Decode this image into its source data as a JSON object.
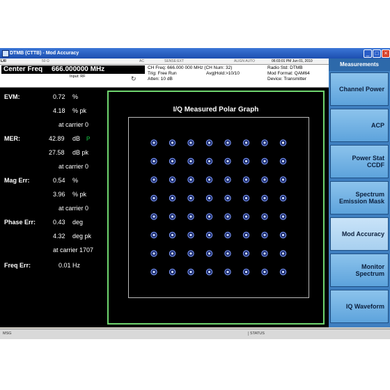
{
  "window": {
    "title": "DTMB (CTTB) - Mod Accuracy",
    "controls": [
      "minimize",
      "maximize",
      "close"
    ]
  },
  "menubar": [
    "50 Ω",
    "AC",
    "SENSE:EXT",
    "ALIGN AUTO",
    "06:03:01 PM Jun 01, 2010"
  ],
  "header": {
    "center_freq_label": "Center Freq",
    "center_freq_value": "666.000000 MHz",
    "input": "Input: RF",
    "ch_freq": "CH Freq: 666.000 000 MHz (CH Num: 32)",
    "trig": "Trig: Free Run",
    "avg_hold": "Avg|Hold:>10/10",
    "atten": "Atten: 10 dB",
    "radio_std": "Radio Std: DTMB",
    "mod_format": "Mod Format: QAM64",
    "device": "Device: Transmitter"
  },
  "measurements": {
    "evm": {
      "label": "EVM:",
      "rms": "0.72",
      "rms_unit": "%",
      "pk": "4.18",
      "pk_unit": "% pk",
      "carrier": "at carrier 0"
    },
    "mer": {
      "label": "MER:",
      "rms": "42.89",
      "rms_unit": "dB",
      "flag": "P",
      "pk": "27.58",
      "pk_unit": "dB pk",
      "carrier": "at carrier 0"
    },
    "mag_err": {
      "label": "Mag Err:",
      "rms": "0.54",
      "rms_unit": "%",
      "pk": "3.96",
      "pk_unit": "% pk",
      "carrier": "at carrier 0"
    },
    "phase_err": {
      "label": "Phase Err:",
      "rms": "0.43",
      "rms_unit": "deg",
      "pk": "4.32",
      "pk_unit": "deg pk",
      "carrier": "at carrier 1707"
    },
    "freq_err": {
      "label": "Freq Err:",
      "value": "0.01 Hz"
    }
  },
  "graph": {
    "title": "I/Q Measured Polar Graph",
    "constellation": {
      "rows": 8,
      "cols": 8,
      "highlight_row": 0,
      "highlight_col": 7
    }
  },
  "sidebar": {
    "title": "Measurements",
    "buttons": [
      {
        "line1": "Channel Power",
        "line2": "",
        "active": false
      },
      {
        "line1": "ACP",
        "line2": "",
        "active": false
      },
      {
        "line1": "Power Stat",
        "line2": "CCDF",
        "active": false
      },
      {
        "line1": "Spectrum",
        "line2": "Emission Mask",
        "active": false
      },
      {
        "line1": "Mod Accuracy",
        "line2": "",
        "active": true
      },
      {
        "line1": "Monitor",
        "line2": "Spectrum",
        "active": false
      },
      {
        "line1": "IQ Waveform",
        "line2": "",
        "active": false
      }
    ]
  },
  "statusbar": {
    "msg": "MSG",
    "status": "STATUS"
  },
  "colors": {
    "accent": "#3f7fc0",
    "graph_border": "#6fd66f",
    "pass": "#19d34a"
  }
}
